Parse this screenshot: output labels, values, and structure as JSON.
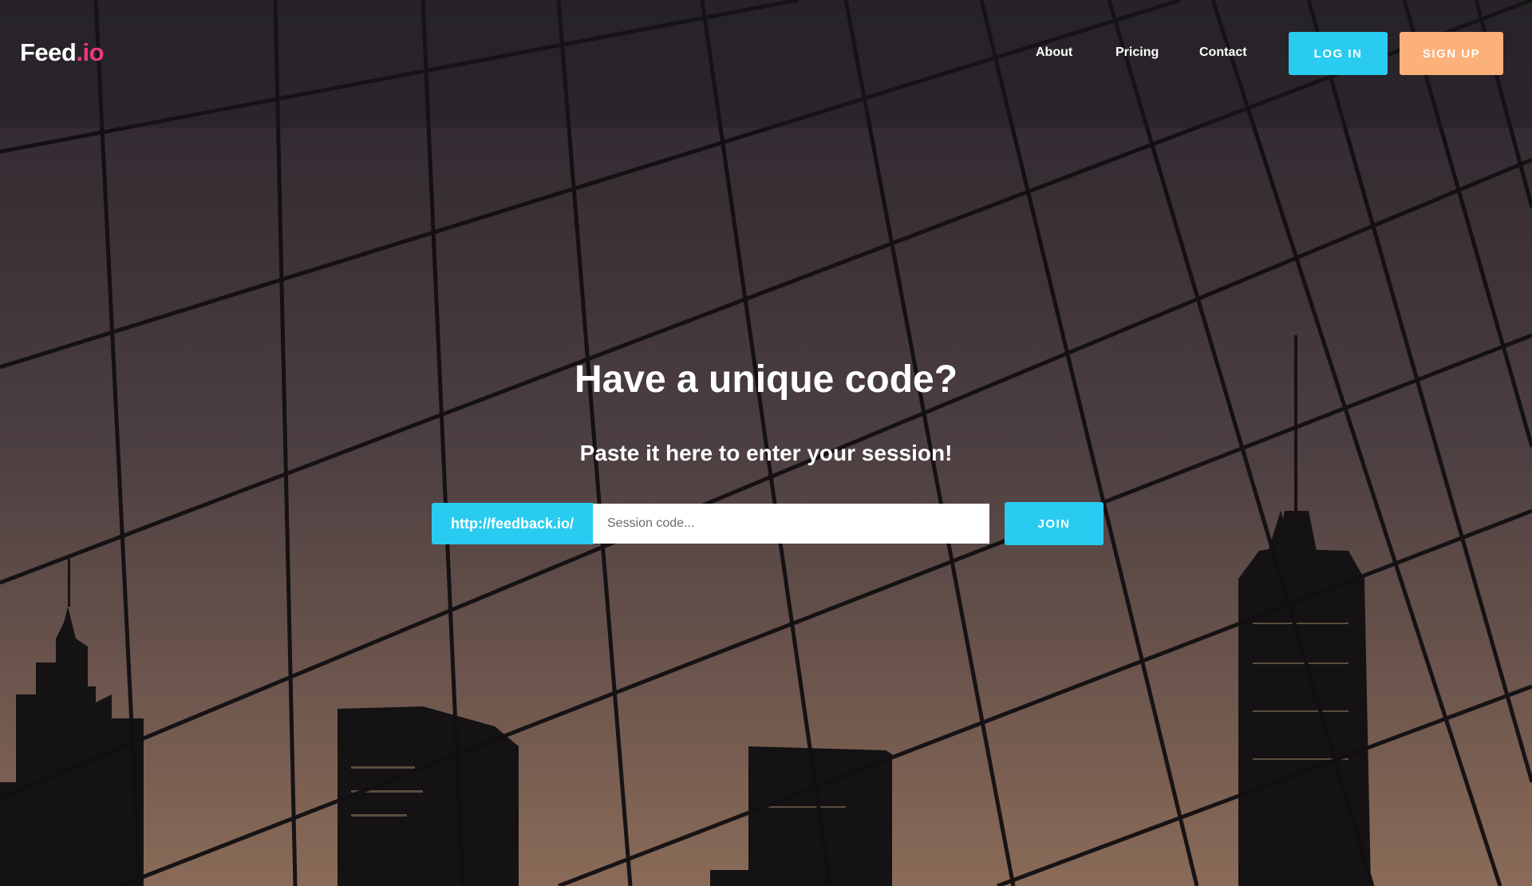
{
  "brand": {
    "name_main": "Feed",
    "name_suffix": ".io",
    "suffix_color": "#ec3a7e"
  },
  "nav": {
    "links": [
      {
        "label": "About"
      },
      {
        "label": "Pricing"
      },
      {
        "label": "Contact"
      }
    ],
    "login_label": "LOG IN",
    "signup_label": "SIGN UP"
  },
  "hero": {
    "headline": "Have a unique code?",
    "subheadline": "Paste it here to enter your session!",
    "url_prefix": "http://feedback.io/",
    "session_placeholder": "Session code...",
    "join_label": "JOIN"
  },
  "colors": {
    "accent": "#29ccf0",
    "signup": "#fdb17a",
    "text": "#ffffff"
  }
}
